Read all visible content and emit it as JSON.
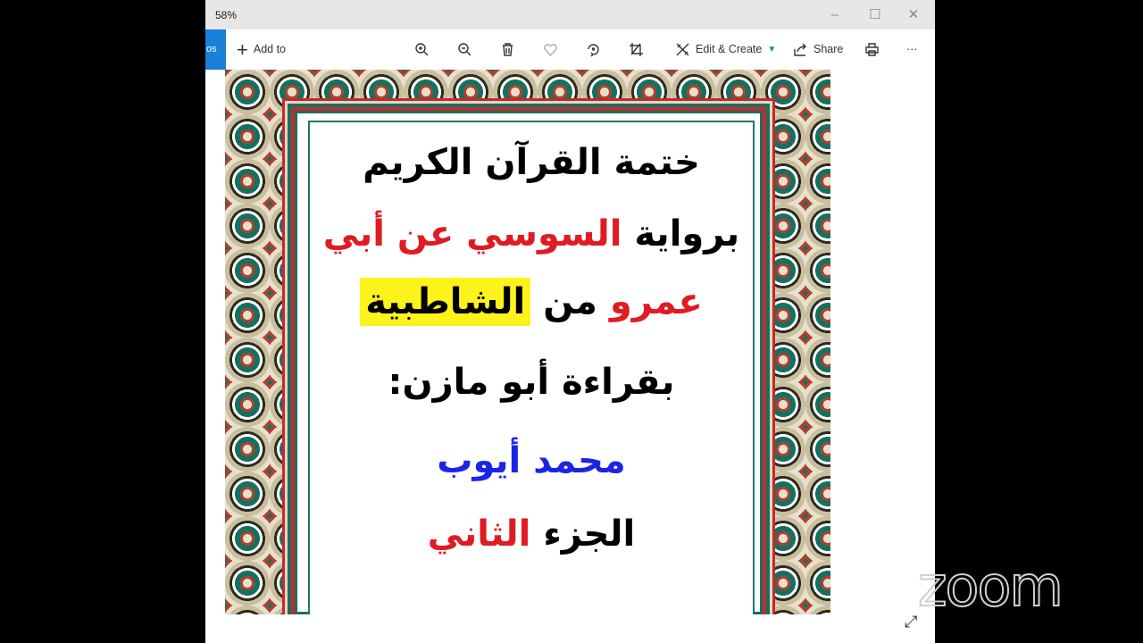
{
  "window": {
    "zoom_level": "58%",
    "minimize": "–",
    "maximize": "☐",
    "close": "✕"
  },
  "toolbar": {
    "back_label": "os",
    "add_to": "Add to",
    "edit_create": "Edit & Create",
    "share": "Share",
    "more": "···"
  },
  "image": {
    "line1": "ختمة القرآن الكريم",
    "line2_a": "برواية",
    "line2_b": "السوسي عن أبي",
    "line3_a": "عمرو",
    "line3_b": "من",
    "line3_c": "الشاطبية",
    "line4": "بقراءة أبو مازن:",
    "line5": "محمد أيوب",
    "line6_a": "الجزء",
    "line6_b": "الثاني"
  },
  "overlay": {
    "watermark": "zoom"
  },
  "colors": {
    "accent": "#1a7fd6",
    "red": "#e01b22",
    "blue": "#1b25e6",
    "highlight": "#fdf21a"
  }
}
